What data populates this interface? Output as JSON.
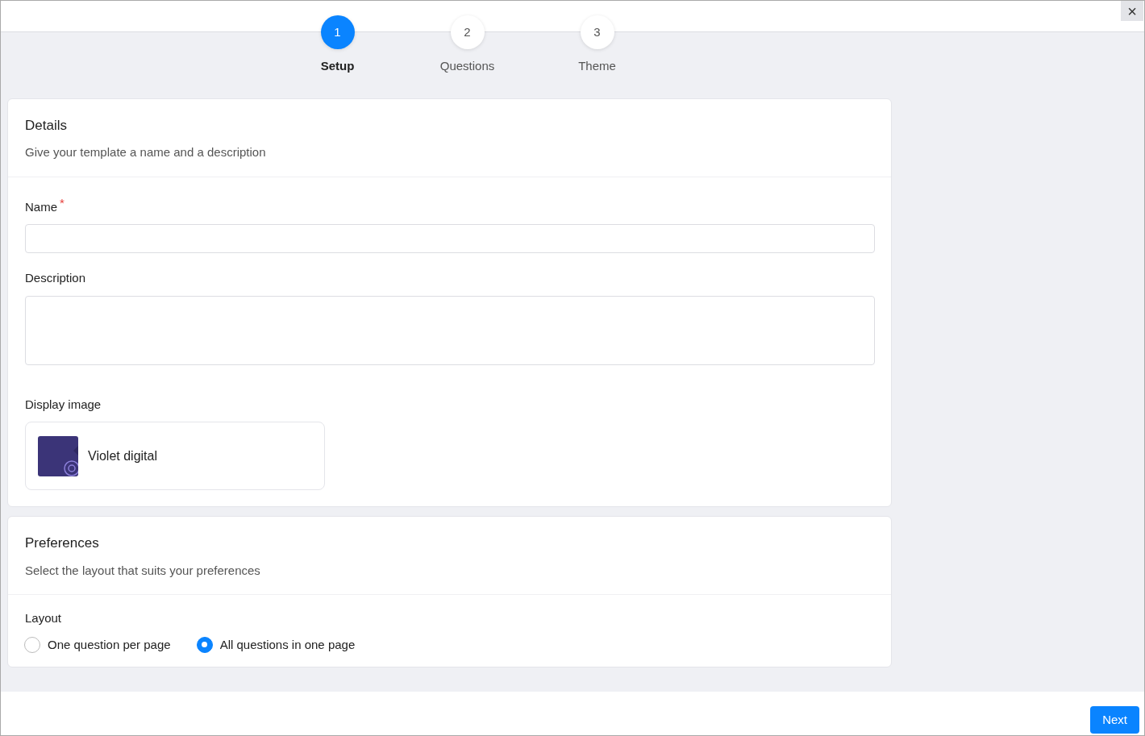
{
  "window": {
    "close": "×"
  },
  "steps": [
    {
      "number": "1",
      "label": "Setup",
      "selected": true
    },
    {
      "number": "2",
      "label": "Questions",
      "selected": false
    },
    {
      "number": "3",
      "label": "Theme",
      "selected": false
    }
  ],
  "details": {
    "title": "Details",
    "subtitle": "Give your template a name and a description",
    "fields": [
      {
        "kind": "text",
        "label": "Name",
        "required_mark": "*"
      },
      {
        "kind": "textarea",
        "label": "Description"
      }
    ],
    "display_image": {
      "label": "Display image",
      "name": "Violet digital"
    }
  },
  "preferences": {
    "title": "Preferences",
    "subtitle": "Select the layout that suits your preferences",
    "layout": {
      "label": "Layout",
      "options": [
        {
          "label": "One question per page",
          "selected": false
        },
        {
          "label": "All questions in one page",
          "selected": true
        }
      ]
    }
  },
  "footer": {
    "next": "Next"
  }
}
